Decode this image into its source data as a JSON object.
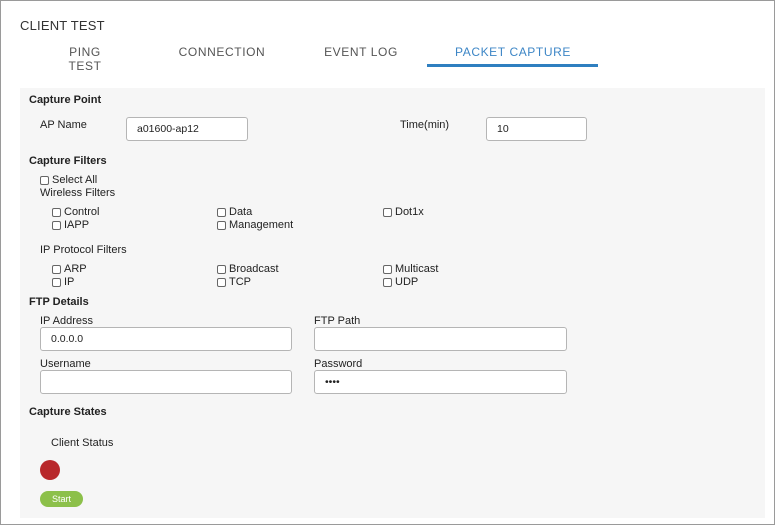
{
  "app": {
    "title": "CLIENT TEST"
  },
  "tabs": [
    {
      "label": "PING TEST"
    },
    {
      "label": "CONNECTION"
    },
    {
      "label": "EVENT LOG"
    },
    {
      "label": "PACKET CAPTURE"
    }
  ],
  "active_tab": "PACKET CAPTURE",
  "capture_point": {
    "title": "Capture Point",
    "ap_name_label": "AP Name",
    "ap_name_value": "a01600-ap12",
    "time_label": "Time(min)",
    "time_value": "10"
  },
  "capture_filters": {
    "title": "Capture Filters",
    "select_all": "Select All",
    "wireless_title": "Wireless Filters",
    "wireless": [
      "Control",
      "Data",
      "Dot1x",
      "IAPP",
      "Management"
    ],
    "ip_title": "IP Protocol Filters",
    "ip": [
      "ARP",
      "Broadcast",
      "Multicast",
      "IP",
      "TCP",
      "UDP"
    ]
  },
  "ftp": {
    "title": "FTP Details",
    "ip_label": "IP Address",
    "ip_value": "0.0.0.0",
    "path_label": "FTP Path",
    "path_value": "",
    "username_label": "Username",
    "username_value": "",
    "password_label": "Password",
    "password_value": "••••"
  },
  "capture_states": {
    "title": "Capture States",
    "client_status_label": "Client Status",
    "status_color": "#b8282b",
    "start_label": "Start"
  },
  "colors": {
    "accent": "#2f7fc0",
    "start": "#8cc04a",
    "panel": "#f6f6f6"
  }
}
